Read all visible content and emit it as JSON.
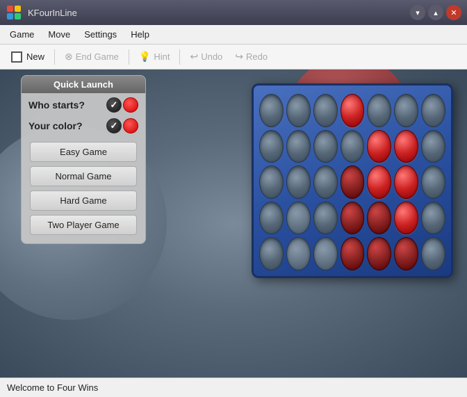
{
  "titlebar": {
    "title": "KFourInLine",
    "app_icon": "grid-icon"
  },
  "titlebar_controls": {
    "minimize_label": "▾",
    "maximize_label": "▴",
    "close_label": "✕"
  },
  "menubar": {
    "items": [
      {
        "label": "Game"
      },
      {
        "label": "Move"
      },
      {
        "label": "Settings"
      },
      {
        "label": "Help"
      }
    ]
  },
  "toolbar": {
    "new_label": "New",
    "end_game_label": "End Game",
    "hint_label": "Hint",
    "undo_label": "Undo",
    "redo_label": "Redo"
  },
  "quick_launch": {
    "header": "Quick Launch",
    "who_starts_label": "Who starts?",
    "your_color_label": "Your color?",
    "buttons": [
      {
        "label": "Easy Game"
      },
      {
        "label": "Normal Game"
      },
      {
        "label": "Hard Game"
      },
      {
        "label": "Two Player Game"
      }
    ]
  },
  "board": {
    "rows": 5,
    "cols": 7,
    "cells": [
      "empty",
      "empty",
      "empty",
      "red",
      "empty",
      "empty",
      "empty",
      "empty",
      "empty",
      "empty",
      "empty",
      "red",
      "red",
      "empty",
      "empty",
      "empty",
      "empty",
      "dark-red",
      "red",
      "red",
      "empty",
      "empty",
      "gray",
      "empty",
      "dark-red",
      "dark-red",
      "red",
      "empty",
      "empty",
      "gray",
      "gray",
      "dark-red",
      "dark-red",
      "dark-red",
      "empty"
    ]
  },
  "statusbar": {
    "text": "Welcome to Four Wins"
  }
}
